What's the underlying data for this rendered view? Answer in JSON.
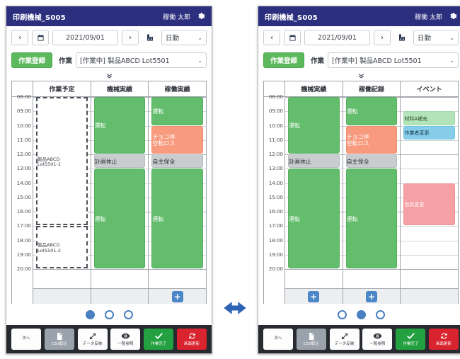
{
  "panels": [
    {
      "id": "left",
      "titlebar": {
        "title": "印刷機械_S005",
        "user": "稼働 太郎",
        "gear_icon": "gear-icon"
      },
      "toolbar": {
        "prev_label": "‹",
        "next_label": "›",
        "calendar_icon": "calendar-icon",
        "date_value": "2021/09/01",
        "building_icon": "factory-icon",
        "shift_value": "日勤",
        "register_label": "作業登録",
        "work_label": "作業",
        "task_value": "[作業中] 製品ABCD Lot5501",
        "expand_icon": "chevron-double-down-icon"
      },
      "columns": [
        "作業予定",
        "機械実績",
        "稼働実績"
      ],
      "times": [
        "08:00",
        "09:00",
        "10:00",
        "11:00",
        "12:00",
        "13:00",
        "14:00",
        "15:00",
        "16:00",
        "17:00",
        "18:00",
        "19:00",
        "20:00"
      ],
      "tracks": [
        {
          "name": "plan",
          "blocks": [
            {
              "label": "製品ABCD\nLot5501-1",
              "start": "08:00",
              "end": "17:00",
              "style": "plan"
            },
            {
              "label": "製品ABCD\nLot5501-2",
              "start": "17:00",
              "end": "20:00",
              "style": "plan"
            }
          ],
          "add_button": null
        },
        {
          "name": "machine",
          "blocks": [
            {
              "label": "運転",
              "start": "08:00",
              "end": "12:00",
              "style": "run"
            },
            {
              "label": "計画休止",
              "start": "12:00",
              "end": "13:00",
              "style": "stop"
            },
            {
              "label": "運転",
              "start": "13:00",
              "end": "20:00",
              "style": "run"
            }
          ],
          "add_button": null
        },
        {
          "name": "operation",
          "blocks": [
            {
              "label": "運転",
              "start": "08:00",
              "end": "10:00",
              "style": "run"
            },
            {
              "label": "チョコ停\n空転ロス",
              "start": "10:00",
              "end": "12:00",
              "style": "choco"
            },
            {
              "label": "自主保全",
              "start": "12:00",
              "end": "13:00",
              "style": "maint"
            },
            {
              "label": "運転",
              "start": "13:00",
              "end": "20:00",
              "style": "run"
            }
          ],
          "add_button": "+"
        }
      ],
      "pager": {
        "count": 3,
        "active": 0
      }
    },
    {
      "id": "right",
      "titlebar": {
        "title": "印刷機械_S005",
        "user": "稼働 太郎",
        "gear_icon": "gear-icon"
      },
      "toolbar": {
        "prev_label": "‹",
        "next_label": "›",
        "calendar_icon": "calendar-icon",
        "date_value": "2021/09/01",
        "building_icon": "factory-icon",
        "shift_value": "日勤",
        "register_label": "作業登録",
        "work_label": "作業",
        "task_value": "[作業中] 製品ABCD Lot5501",
        "expand_icon": "chevron-double-down-icon"
      },
      "columns": [
        "機械実績",
        "稼働記録",
        "イベント"
      ],
      "times": [
        "08:00",
        "09:00",
        "10:00",
        "11:00",
        "12:00",
        "13:00",
        "14:00",
        "15:00",
        "16:00",
        "17:00",
        "18:00",
        "19:00",
        "20:00"
      ],
      "tracks": [
        {
          "name": "machine",
          "blocks": [
            {
              "label": "運転",
              "start": "08:00",
              "end": "12:00",
              "style": "run"
            },
            {
              "label": "計画休止",
              "start": "12:00",
              "end": "13:00",
              "style": "stop"
            },
            {
              "label": "運転",
              "start": "13:00",
              "end": "20:00",
              "style": "run"
            }
          ],
          "add_button": "+"
        },
        {
          "name": "operation-record",
          "blocks": [
            {
              "label": "運転",
              "start": "08:00",
              "end": "10:00",
              "style": "run"
            },
            {
              "label": "チョコ停\n空転ロス",
              "start": "10:00",
              "end": "12:00",
              "style": "choco"
            },
            {
              "label": "自主保全",
              "start": "12:00",
              "end": "13:00",
              "style": "maint"
            },
            {
              "label": "運転",
              "start": "13:00",
              "end": "20:00",
              "style": "run"
            }
          ],
          "add_button": "+"
        },
        {
          "name": "event",
          "blocks": [
            {
              "label": "材料A補充",
              "start": "09:00",
              "end": "10:00",
              "style": "ev-green"
            },
            {
              "label": "作業者変更",
              "start": "10:00",
              "end": "11:00",
              "style": "ev-blue"
            },
            {
              "label": "治具変更",
              "start": "14:00",
              "end": "17:00",
              "style": "ev-pink"
            }
          ],
          "add_button": null
        }
      ],
      "pager": {
        "count": 3,
        "active": 1
      }
    }
  ],
  "bottombar": {
    "buttons": [
      {
        "label": "次へ",
        "icon": "none",
        "style": "white"
      },
      {
        "label": "CSV取込",
        "icon": "import-icon",
        "style": "gray"
      },
      {
        "label": "データ反映",
        "icon": "sync-data-icon",
        "style": "white"
      },
      {
        "label": "一覧参照",
        "icon": "eye-icon",
        "style": "white"
      },
      {
        "label": "作業完了",
        "icon": "check-icon",
        "style": "green"
      },
      {
        "label": "画面更新",
        "icon": "refresh-icon",
        "style": "red"
      }
    ]
  },
  "center_arrow": {
    "icon": "double-arrow-horizontal-icon",
    "color": "#2d63b5"
  },
  "colors": {
    "titlebar": "#2b2f7e",
    "run": "#63bd6c",
    "stop": "#c9cdd0",
    "choco": "#f79a7d",
    "event_green": "#b3e3b8",
    "event_blue": "#86cdea",
    "event_pink": "#f5a0a4",
    "accent_blue": "#4a7fc1",
    "bottombar": "#272b30"
  }
}
